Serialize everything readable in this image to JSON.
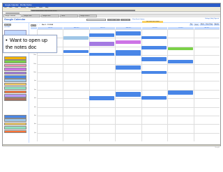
{
  "browser": {
    "title": "Google Calendar - Mozilla Firefox",
    "menu": [
      "File",
      "Edit",
      "View",
      "History",
      "Bookmarks",
      "Tools",
      "Help"
    ],
    "url": "https://www.google.com/calendar/render"
  },
  "tabs": [
    {
      "label": "Google Calendar"
    },
    {
      "label": "Google Labs"
    },
    {
      "label": "Google Docs"
    },
    {
      "label": "Gmail"
    },
    {
      "label": "Google Search"
    }
  ],
  "calendar_header": {
    "logo": "Google Calendar",
    "search_public_button": "Search Public Calendars",
    "search_my_button": "Search My Calendars",
    "options_link": "Show Search Options",
    "notice": "Your event was created",
    "user_links": "Settings | Help | Sign out"
  },
  "sidebar": {
    "create_button": "Create Event",
    "quick_add": "Quick Add"
  },
  "calendar_colors": [
    "#f4b400",
    "#7bd148",
    "#f691b2",
    "#cd74e6",
    "#a47ae2",
    "#4986e7",
    "#9fc6e7",
    "#fad165",
    "#92e1c0",
    "#ff7537",
    "#b99aff",
    "#ac725e"
  ],
  "nav": {
    "today_button": "Today",
    "prev": "‹",
    "next": "›",
    "range": "Mar 9 – 15 2008",
    "views": [
      "Day",
      "Week",
      "Month",
      "Next 4 Days",
      "Agenda"
    ]
  },
  "days": [
    "Sun 3/9",
    "Mon 3/10",
    "Tue 3/11",
    "Wed 3/12",
    "Thu 3/13",
    "Fri 3/14",
    "Sat 3/15"
  ],
  "hours": [
    "7am",
    "8am",
    "9am",
    "10am",
    "11am",
    "12pm",
    "1pm",
    "2pm",
    "3pm",
    "4pm",
    "5pm",
    "6pm",
    "7pm"
  ],
  "callout": {
    "bullet": "•",
    "text": "Want to open up the notes doc"
  },
  "footer": "Google"
}
